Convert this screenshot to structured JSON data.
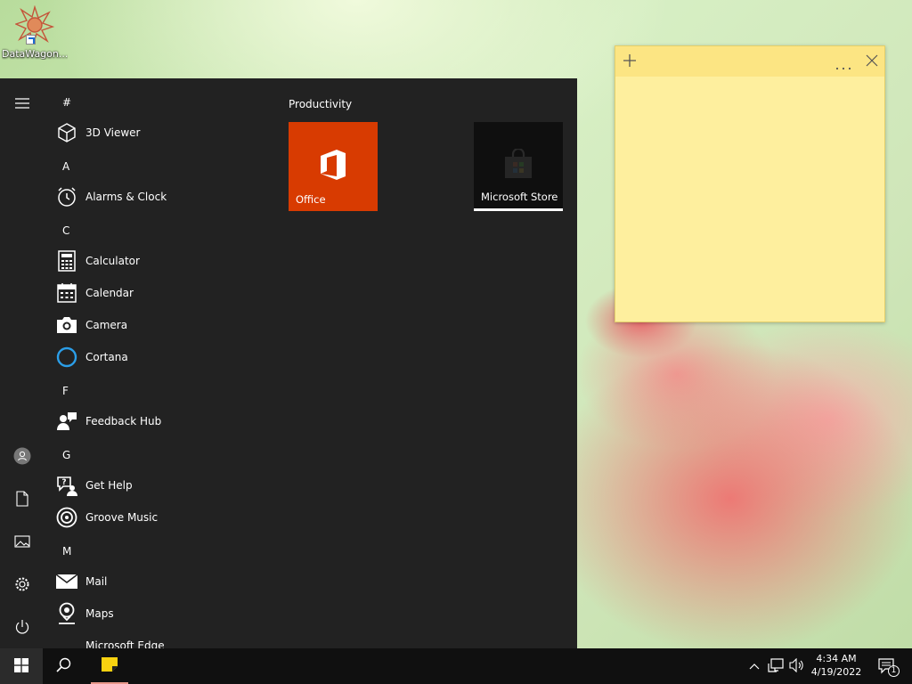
{
  "desktop": {
    "icons": [
      {
        "label": "DataWagon...",
        "icon": "datawagon-app-icon"
      }
    ]
  },
  "start_menu": {
    "rail": [
      "hamburger-menu-icon",
      "user-avatar-icon",
      "documents-icon",
      "pictures-icon",
      "settings-icon",
      "power-icon"
    ],
    "app_list": [
      {
        "type": "header",
        "label": "#"
      },
      {
        "type": "app",
        "label": "3D Viewer",
        "icon": "3d-cube-icon"
      },
      {
        "type": "header",
        "label": "A"
      },
      {
        "type": "app",
        "label": "Alarms & Clock",
        "icon": "alarm-clock-icon"
      },
      {
        "type": "header",
        "label": "C"
      },
      {
        "type": "app",
        "label": "Calculator",
        "icon": "calculator-icon"
      },
      {
        "type": "app",
        "label": "Calendar",
        "icon": "calendar-icon"
      },
      {
        "type": "app",
        "label": "Camera",
        "icon": "camera-icon"
      },
      {
        "type": "app",
        "label": "Cortana",
        "icon": "cortana-ring-icon"
      },
      {
        "type": "header",
        "label": "F"
      },
      {
        "type": "app",
        "label": "Feedback Hub",
        "icon": "feedback-hub-icon"
      },
      {
        "type": "header",
        "label": "G"
      },
      {
        "type": "app",
        "label": "Get Help",
        "icon": "get-help-icon"
      },
      {
        "type": "app",
        "label": "Groove Music",
        "icon": "groove-music-icon"
      },
      {
        "type": "header",
        "label": "M"
      },
      {
        "type": "app",
        "label": "Mail",
        "icon": "mail-envelope-icon"
      },
      {
        "type": "app",
        "label": "Maps",
        "icon": "maps-pin-icon"
      },
      {
        "type": "app",
        "label": "Microsoft Edge",
        "icon": "edge-icon"
      }
    ],
    "tile_group": "Productivity",
    "tiles": [
      {
        "label": "Office",
        "color": "#d83b01",
        "icon": "office-logo-icon"
      },
      {
        "label": "Microsoft Store",
        "color": "#0f0f0f",
        "icon": "store-bag-icon"
      }
    ]
  },
  "sticky_note": {
    "add_icon": "plus-icon",
    "menu_icon": "ellipsis-icon",
    "close_icon": "close-icon",
    "content": ""
  },
  "taskbar": {
    "start_icon": "windows-logo-icon",
    "search_icon": "search-icon",
    "pinned": [
      {
        "name": "Sticky Notes",
        "icon": "sticky-notes-icon",
        "active": true
      }
    ],
    "tray": {
      "icons": [
        "chevron-up-icon",
        "network-icon",
        "volume-icon"
      ],
      "time": "4:34 AM",
      "date": "4/19/2022",
      "notification_count": "1"
    }
  }
}
